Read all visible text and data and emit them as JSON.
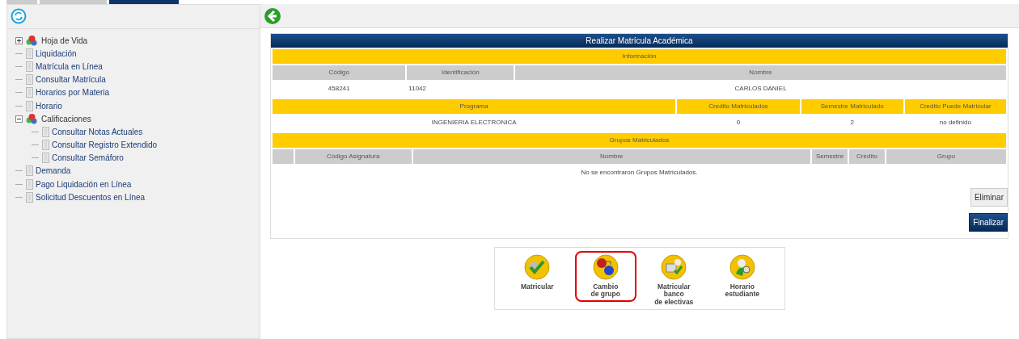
{
  "tabs": [
    {
      "selected": false
    },
    {
      "selected": false
    },
    {
      "selected": true
    }
  ],
  "sidebar": {
    "tree": [
      {
        "label": "Hoja de Vida",
        "kind": "folder",
        "expanded": false
      },
      {
        "label": "Liquidación",
        "kind": "page"
      },
      {
        "label": "Matrícula en Línea",
        "kind": "page"
      },
      {
        "label": "Consultar Matrícula",
        "kind": "page"
      },
      {
        "label": "Horarios por Materia",
        "kind": "page"
      },
      {
        "label": "Horario",
        "kind": "page"
      },
      {
        "label": "Calificaciones",
        "kind": "folder",
        "expanded": true,
        "children": [
          {
            "label": "Consultar Notas Actuales",
            "kind": "page"
          },
          {
            "label": "Consultar Registro Extendido",
            "kind": "page"
          },
          {
            "label": "Consultar Semáforo",
            "kind": "page"
          }
        ]
      },
      {
        "label": "Demanda",
        "kind": "page"
      },
      {
        "label": "Pago Liquidación en Línea",
        "kind": "page"
      },
      {
        "label": "Solicitud Descuentos en Línea",
        "kind": "page"
      }
    ]
  },
  "panel": {
    "title": "Realizar Matrícula Académica",
    "info": {
      "heading": "Información",
      "columns": [
        "Código",
        "Identificación",
        "Nombre"
      ],
      "row": [
        "458241",
        "11042",
        "CARLOS DANIEL"
      ]
    },
    "program": {
      "columns": [
        "Programa",
        "Credito Matriculados",
        "Semestre Matriculado",
        "Credito Puede Matricular"
      ],
      "row": [
        "INGENIERIA ELECTRONICA",
        "0",
        "2",
        "no definido"
      ]
    },
    "groups": {
      "heading": "Grupos Matriculados",
      "columns": [
        "",
        "Código Asignatura",
        "Nombre",
        "Semestre",
        "Credito",
        "Grupo"
      ],
      "empty_message": "No se encontraron Grupos Matriculados."
    },
    "buttons": [
      {
        "label": "Eliminar",
        "kind": "light"
      },
      {
        "label": "Finalizar",
        "kind": "dark"
      }
    ]
  },
  "actions": [
    {
      "label": "Matricular",
      "kind": "enroll",
      "highlighted": false
    },
    {
      "label": "Cambio\nde grupo",
      "kind": "swap",
      "highlighted": true
    },
    {
      "label": "Matricular\nbanco\nde electivas",
      "kind": "electives",
      "highlighted": false
    },
    {
      "label": "Horario\nestudiante",
      "kind": "schedule",
      "highlighted": false
    }
  ]
}
